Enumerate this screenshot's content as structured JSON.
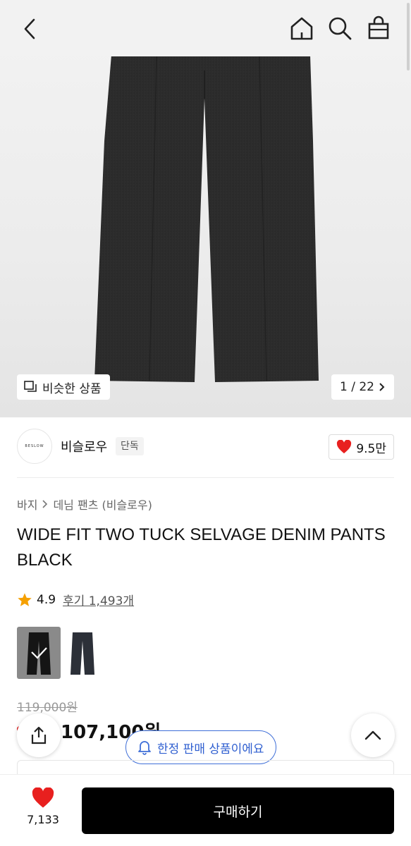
{
  "header": {
    "back_icon": "chevron-left-icon",
    "home_icon": "home-icon",
    "search_icon": "search-icon",
    "cart_icon": "shopping-bag-icon"
  },
  "gallery": {
    "similar_label": "비슷한 상품",
    "counter": "1 / 22"
  },
  "brand": {
    "logo_text": "BESLOW",
    "name": "비슬로우",
    "tag": "단독",
    "likes": "9.5만"
  },
  "breadcrumb": {
    "category": "바지",
    "sub": "데님 팬츠 (비슬로우)"
  },
  "product": {
    "title": "WIDE FIT TWO TUCK SELVAGE DENIM PANTS BLACK",
    "rating": "4.9",
    "review_label": "후기 1,493개",
    "original_price": "119,000원",
    "sale_price": "107,100원"
  },
  "notice": {
    "limited_label": "한정 판매 상품이에요"
  },
  "bottom": {
    "like_count": "7,133",
    "buy_label": "구매하기"
  },
  "colors": {
    "accent_blue": "#2f5fd0",
    "heart_red": "#e8201f",
    "star_orange": "#f5a000"
  }
}
